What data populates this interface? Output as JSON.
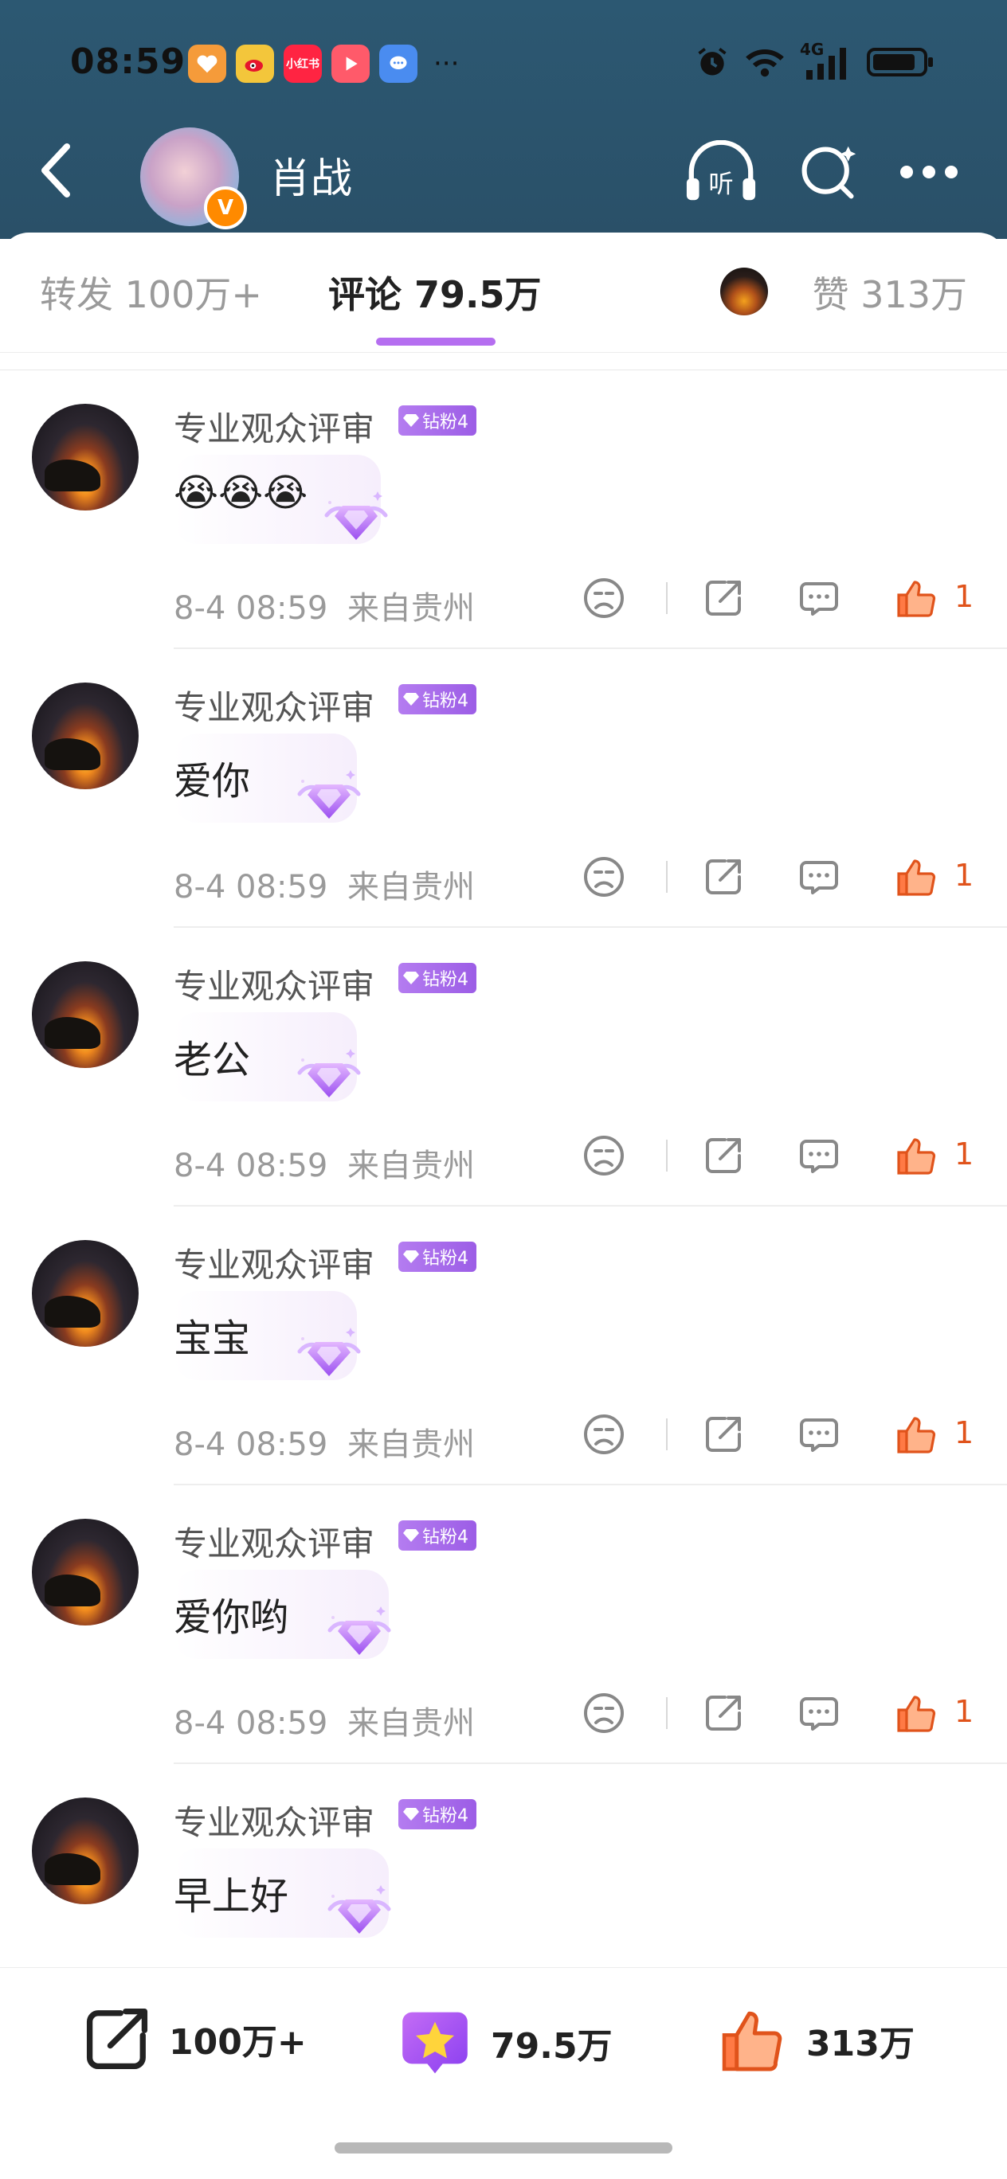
{
  "status_bar": {
    "time": "08:59",
    "apps": [
      {
        "name": "heart-app",
        "label": "",
        "color": "#f59b3a"
      },
      {
        "name": "weibo-app",
        "label": "",
        "color": "#f3c63b"
      },
      {
        "name": "xiaohongshu-app",
        "label": "小红书",
        "color": "#ff2442"
      },
      {
        "name": "video-app",
        "label": "",
        "color": "#ff5a6a"
      },
      {
        "name": "message-app",
        "label": "",
        "color": "#4a8cf0"
      }
    ],
    "overflow": "···",
    "network": "4G"
  },
  "header": {
    "title": "肖战",
    "verified_mark": "V"
  },
  "tabs": {
    "repost": "转发 100万+",
    "comments": "评论 79.5万",
    "likes": "赞 313万"
  },
  "comments": [
    {
      "user": "专业观众评审",
      "badge": "钻粉4",
      "text": "😭😭😭",
      "time": "8-4 08:59",
      "location": "来自贵州",
      "likes": "1"
    },
    {
      "user": "专业观众评审",
      "badge": "钻粉4",
      "text": "爱你",
      "time": "8-4 08:59",
      "location": "来自贵州",
      "likes": "1"
    },
    {
      "user": "专业观众评审",
      "badge": "钻粉4",
      "text": "老公",
      "time": "8-4 08:59",
      "location": "来自贵州",
      "likes": "1"
    },
    {
      "user": "专业观众评审",
      "badge": "钻粉4",
      "text": "宝宝",
      "time": "8-4 08:59",
      "location": "来自贵州",
      "likes": "1"
    },
    {
      "user": "专业观众评审",
      "badge": "钻粉4",
      "text": "爱你哟",
      "time": "8-4 08:59",
      "location": "来自贵州",
      "likes": "1"
    },
    {
      "user": "专业观众评审",
      "badge": "钻粉4",
      "text": "早上好",
      "time": "",
      "location": "",
      "likes": ""
    }
  ],
  "bottom_bar": {
    "repost_count": "100万+",
    "comment_count": "79.5万",
    "like_count": "313万"
  },
  "colors": {
    "header_bg": "#2c5872",
    "accent_purple": "#b56ef0",
    "like_orange": "#e0531b"
  }
}
